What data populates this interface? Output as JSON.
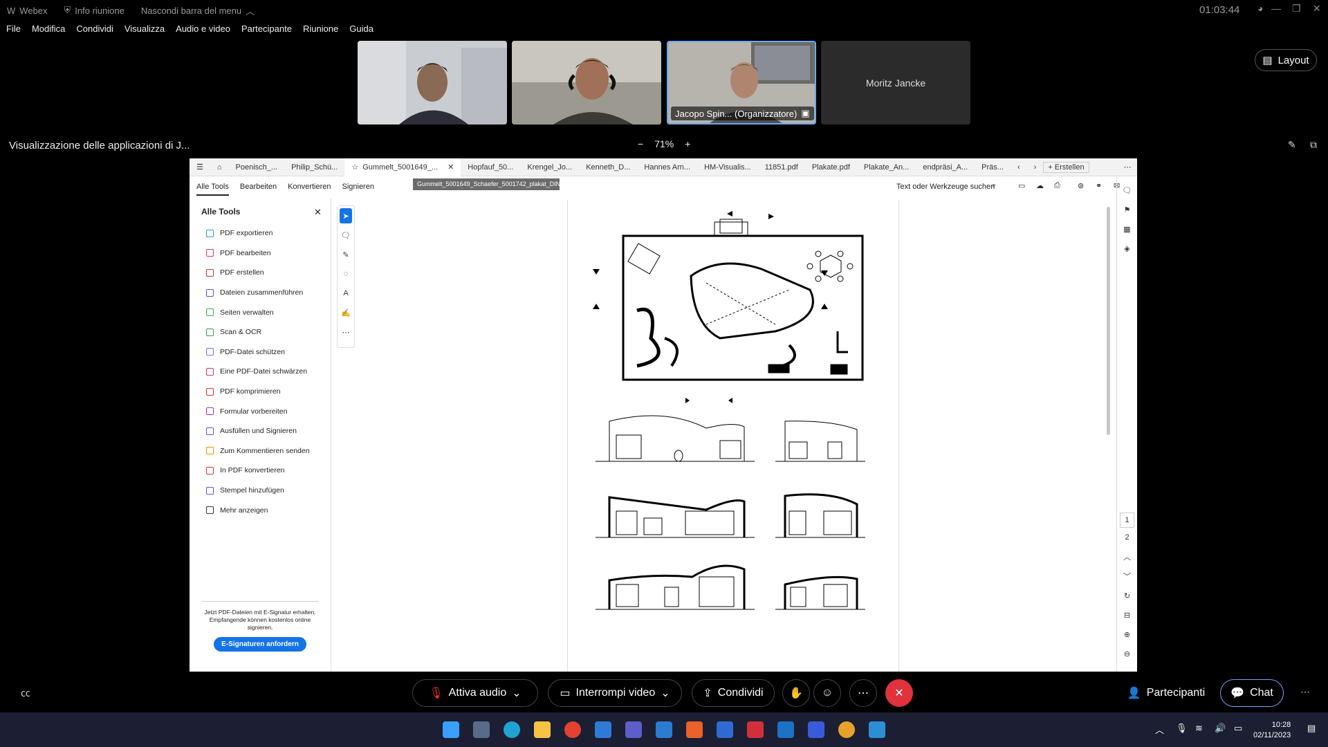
{
  "window": {
    "app_name": "Webex",
    "info_label": "Info riunione",
    "hide_menu_label": "Nascondi barra del menu",
    "timer": "01:03:44"
  },
  "menu": [
    "File",
    "Modifica",
    "Condividi",
    "Visualizza",
    "Audio e video",
    "Partecipante",
    "Riunione",
    "Guida"
  ],
  "participants": {
    "organizer_tag": "Jacopo Spin... (Organizzatore)",
    "name_tile": "Moritz Jancke"
  },
  "layout_label": "Layout",
  "share": {
    "title": "Visualizzazione delle applicazioni di J...",
    "zoom_level": "71%",
    "zoom_minus": "−",
    "zoom_plus": "+"
  },
  "acrobat": {
    "tabs": [
      "Poenisch_...",
      "Philip_Schü...",
      "Gummelt_5001649_...",
      "Hopfauf_50...",
      "Krengel_Jo...",
      "Kenneth_D...",
      "Hannes Arn...",
      "HM-Visualis...",
      "11851.pdf",
      "Plakate.pdf",
      "Plakate_An...",
      "endpräsi_A...",
      "Präs..."
    ],
    "create_label": "Erstellen",
    "tooltip": "Gummelt_5001649_Schaefer_5001742_plakat_DIN_A1.pdf",
    "toolbar": [
      "Alle Tools",
      "Bearbeiten",
      "Konvertieren",
      "Signieren"
    ],
    "search_label": "Text oder Werkzeuge suchen",
    "panel_title": "Alle Tools",
    "tools": [
      {
        "label": "PDF exportieren",
        "color": "#2d9bd1"
      },
      {
        "label": "PDF bearbeiten",
        "color": "#d6336c"
      },
      {
        "label": "PDF erstellen",
        "color": "#d63333"
      },
      {
        "label": "Dateien zusammenführen",
        "color": "#7048e8"
      },
      {
        "label": "Seiten verwalten",
        "color": "#37b24d"
      },
      {
        "label": "Scan & OCR",
        "color": "#2f9e44"
      },
      {
        "label": "PDF-Datei schützen",
        "color": "#5c7cfa"
      },
      {
        "label": "Eine PDF-Datei schwärzen",
        "color": "#d6336c"
      },
      {
        "label": "PDF komprimieren",
        "color": "#d63333"
      },
      {
        "label": "Formular vorbereiten",
        "color": "#9c36b5"
      },
      {
        "label": "Ausfüllen und Signieren",
        "color": "#7048e8"
      },
      {
        "label": "Zum Kommentieren senden",
        "color": "#f08c00"
      },
      {
        "label": "In PDF konvertieren",
        "color": "#d63333"
      },
      {
        "label": "Stempel hinzufügen",
        "color": "#7048e8"
      },
      {
        "label": "Mehr anzeigen",
        "color": "#333333"
      }
    ],
    "promo_text": "Jetzt PDF-Dateien mit E-Signatur erhalten. Empfangende können kostenlos online signieren.",
    "promo_button": "E-Signaturen anfordern",
    "page_numbers": [
      "1",
      "2"
    ]
  },
  "controls": {
    "audio": "Attiva audio",
    "video": "Interrompi video",
    "share": "Condividi",
    "participants": "Partecipanti",
    "chat": "Chat"
  },
  "taskbar": {
    "time": "10:28",
    "date": "02/11/2023"
  }
}
